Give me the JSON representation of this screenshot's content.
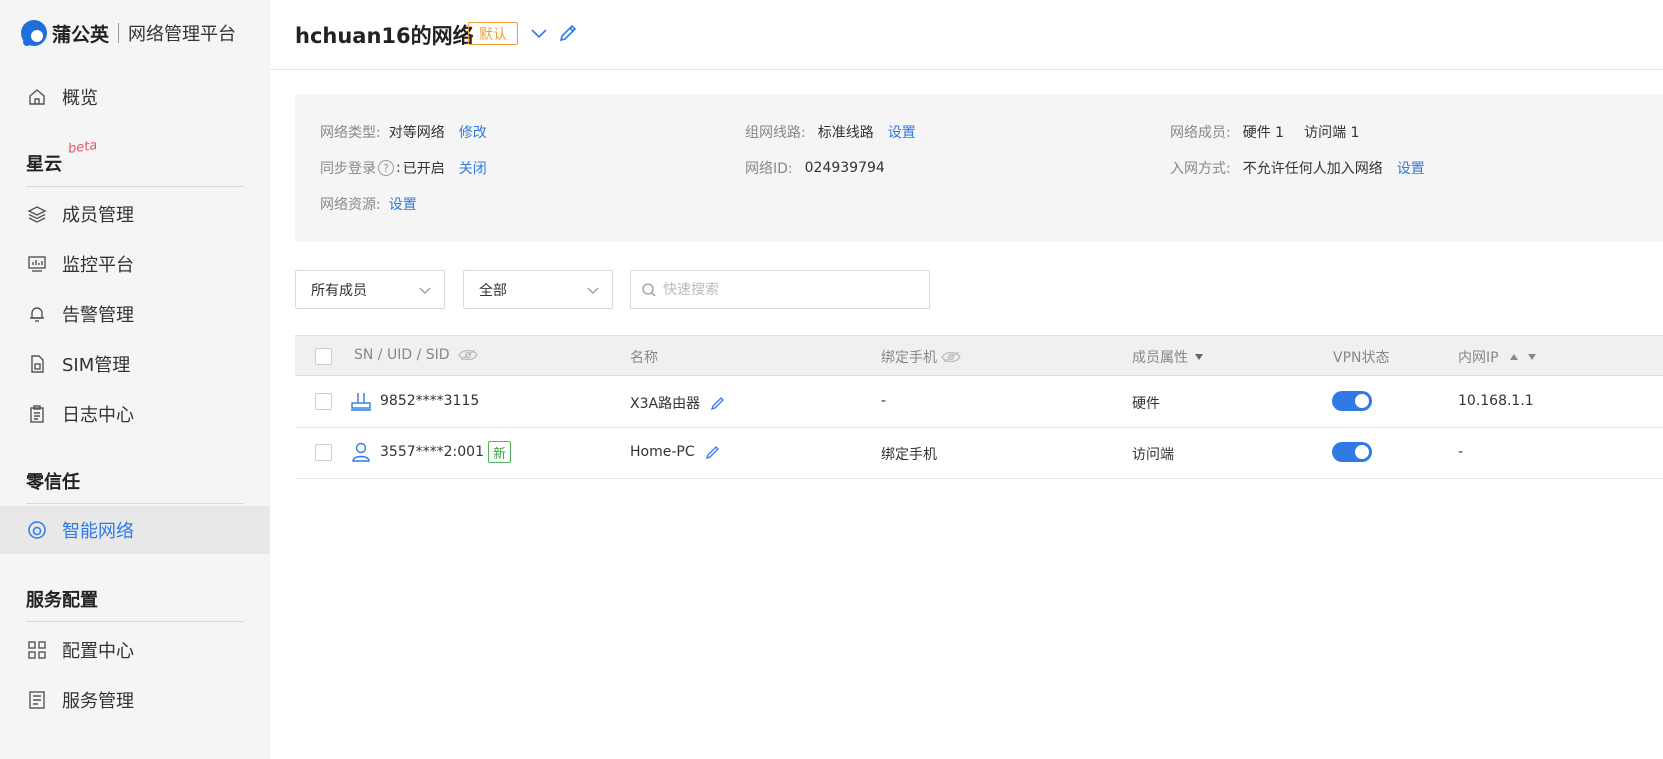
{
  "brand": {
    "name": "蒲公英",
    "platform": "网络管理平台"
  },
  "sidebar": {
    "overview": "概览",
    "section_xingyun": "星云",
    "beta": "beta",
    "xingyun_items": [
      "成员管理",
      "监控平台",
      "告警管理",
      "SIM管理",
      "日志中心"
    ],
    "section_zero_trust": "零信任",
    "zero_trust_items": [
      "智能网络"
    ],
    "section_service": "服务配置",
    "service_items": [
      "配置中心",
      "服务管理"
    ]
  },
  "header": {
    "title": "hchuan16的网络",
    "badge": "默认"
  },
  "info": {
    "network_type_label": "网络类型:",
    "network_type_value": "对等网络",
    "network_type_action": "修改",
    "route_label": "组网线路:",
    "route_value": "标准线路",
    "route_action": "设置",
    "members_label": "网络成员:",
    "members_hw": "硬件 1",
    "members_visitor": "访问端 1",
    "sync_login_label": "同步登录",
    "sync_login_colon": ":",
    "sync_login_value": "已开启",
    "sync_login_action": "关闭",
    "network_id_label": "网络ID:",
    "network_id_value": "024939794",
    "join_label": "入网方式:",
    "join_value": "不允许任何人加入网络",
    "join_action": "设置",
    "resource_label": "网络资源:",
    "resource_action": "设置"
  },
  "filters": {
    "member_select": "所有成员",
    "status_select": "全部",
    "search_placeholder": "快速搜索"
  },
  "table": {
    "headers": {
      "sn": "SN / UID / SID",
      "name": "名称",
      "phone": "绑定手机",
      "attr": "成员属性",
      "vpn": "VPN状态",
      "ip": "内网IP"
    },
    "rows": [
      {
        "sn": "9852****3115",
        "tag": "",
        "name": "X3A路由器",
        "phone": "-",
        "phone_is_link": false,
        "attr": "硬件",
        "vpn_on": true,
        "ip": "10.168.1.1",
        "type": "router"
      },
      {
        "sn": "3557****2:001",
        "tag": "新",
        "name": "Home-PC",
        "phone": "绑定手机",
        "phone_is_link": true,
        "attr": "访问端",
        "vpn_on": true,
        "ip": "-",
        "type": "user"
      }
    ]
  },
  "colors": {
    "accent": "#2f7ae5",
    "badge_orange": "#f0a030",
    "tag_green": "#3aa545"
  }
}
